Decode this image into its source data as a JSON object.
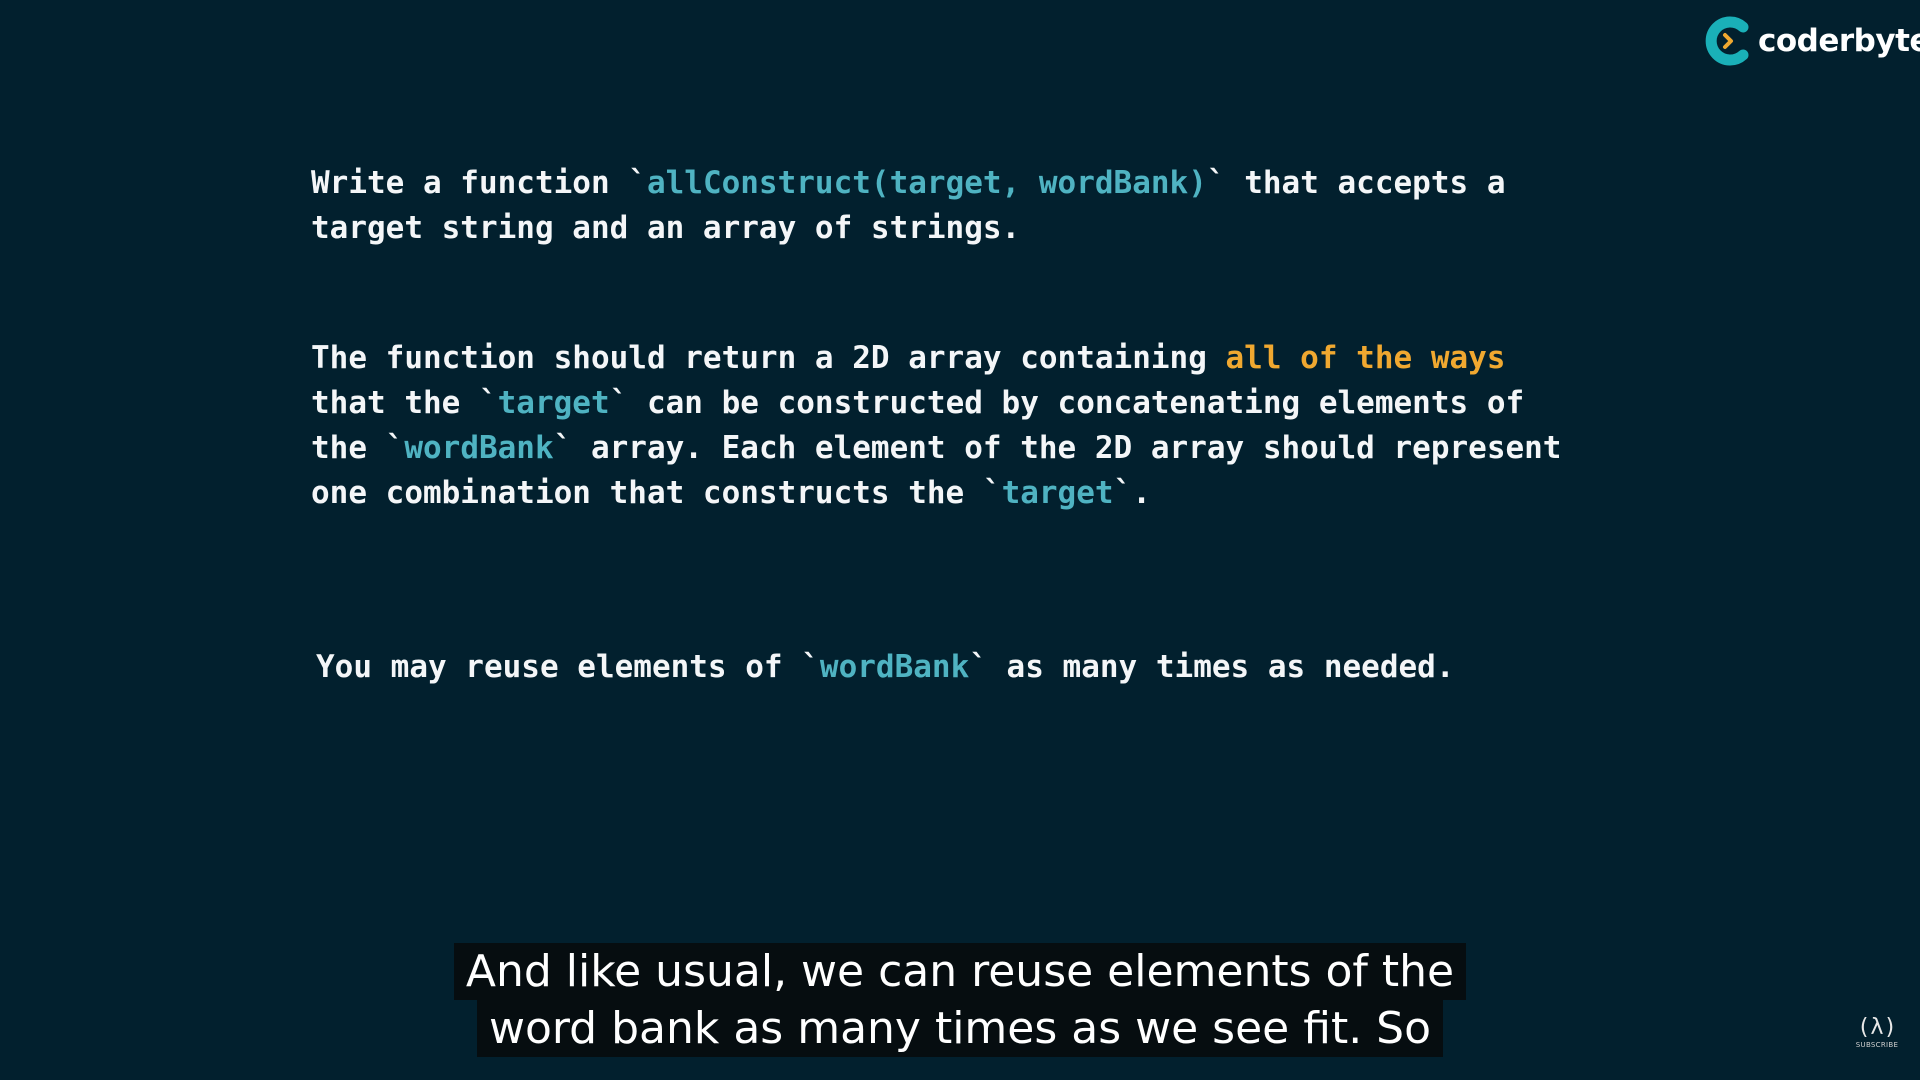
{
  "brand": {
    "name": "coderbyte",
    "ring_color": "#1ab0b8",
    "arrow_color": "#f0a830"
  },
  "problem": {
    "para1": {
      "line1": {
        "a": "Write a function `",
        "code": "allConstruct(target, wordBank)",
        "b": "` that accepts a"
      },
      "line2": "target string and an array of strings."
    },
    "para2": {
      "line1": {
        "a": "The function should return a 2D array containing ",
        "highlight": "all of the ways"
      },
      "line2": {
        "a": "that the `",
        "code": "target",
        "b": "` can be constructed by concatenating elements of"
      },
      "line3": {
        "a": "the `",
        "code": "wordBank",
        "b": "` array. Each element of the 2D array should represent"
      },
      "line4": {
        "a": "one combination that constructs the `",
        "code": "target",
        "b": "`."
      }
    },
    "para3": {
      "a": "You may reuse elements of `",
      "code": "wordBank",
      "b": "` as many times as needed."
    }
  },
  "captions": {
    "line1": "And like usual, we can reuse elements of the",
    "line2": "word bank as many times as we see fit. So"
  },
  "channel_badge": {
    "icon": "(λ)",
    "label": "SUBSCRIBE"
  }
}
